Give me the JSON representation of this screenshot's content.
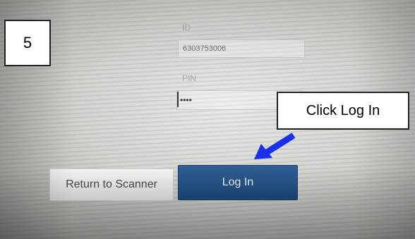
{
  "step": {
    "number": "5"
  },
  "form": {
    "id_label": "ID",
    "id_value": "6303753006",
    "pin_label": "PIN",
    "pin_value": "••••"
  },
  "annotation": {
    "callout_text": "Click Log In",
    "arrow_color": "#1a2fe8"
  },
  "buttons": {
    "return_label": "Return to Scanner",
    "login_label": "Log In"
  },
  "colors": {
    "login_button": "#254f84",
    "return_button": "#eeeeec"
  }
}
